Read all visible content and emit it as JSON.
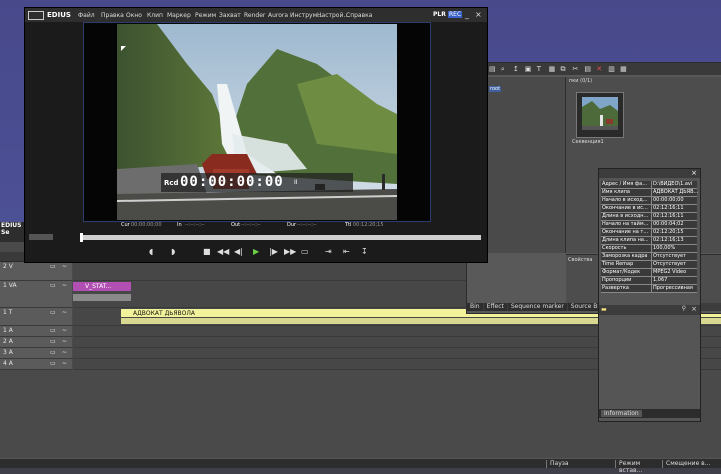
{
  "player": {
    "logo": "EDIUS",
    "menu": [
      "Файл",
      "Правка",
      "Окно",
      "Клип",
      "Маркер",
      "Режим",
      "Захват",
      "Render",
      "Aurora",
      "Инструм...",
      "Настрой...",
      "Справка"
    ],
    "plr": "PLR",
    "rec": "REC",
    "timecode_label": "Rcd",
    "timecode": "00:00:00:00",
    "timecode_suffix": "II",
    "cur_label": "Cur",
    "cur_value": "00:00:00;00",
    "in_label": "In",
    "in_value": "--:--:--;--",
    "out_label": "Out",
    "out_value": "--:--:--;--",
    "dur_label": "Dur",
    "dur_value": "--:--:--;--",
    "ttl_label": "Ttl",
    "ttl_value": "00:12:20;15"
  },
  "bin": {
    "folder": "root",
    "header": "пки (0/1)",
    "clip_name": "Секвенция1",
    "tabs": [
      "Bin",
      "Effect",
      "Sequence marker",
      "Source Brow"
    ],
    "props_label": "Свойства"
  },
  "info": {
    "rows": [
      {
        "k": "Адрес / Имя фа...",
        "v": "D:\\ВИДЕО\\1.avi"
      },
      {
        "k": "Имя клипа",
        "v": "АДВОКАТ ДЬЯВ..."
      },
      {
        "k": "Начало в исход...",
        "v": "00:00:00;00"
      },
      {
        "k": "Окончание в ис...",
        "v": "02:12:16;11"
      },
      {
        "k": "Длина в исходн...",
        "v": "02:12:16;11"
      },
      {
        "k": "Начало на тайм...",
        "v": "00:00:04;02"
      },
      {
        "k": "Окончание на т...",
        "v": "02:12:20;15"
      },
      {
        "k": "Длина клипа на...",
        "v": "02:12:16;13"
      },
      {
        "k": "Скорость",
        "v": "100,00%"
      },
      {
        "k": "Заморозка кадра",
        "v": "Отсутствует"
      },
      {
        "k": "Time Remap",
        "v": "Отсутствует"
      },
      {
        "k": "Формат/Кодек",
        "v": "MPEG2 Video"
      },
      {
        "k": "Пропорции",
        "v": "1,067"
      },
      {
        "k": "Развертка",
        "v": "Прогрессивная"
      }
    ],
    "tab": "Information"
  },
  "timeline": {
    "title": "EDIUS Se",
    "tracks": [
      {
        "id": "2 V",
        "h": 19
      },
      {
        "id": "1 VA",
        "h": 27
      },
      {
        "id": "1 T",
        "h": 18
      },
      {
        "id": "1 A",
        "h": 11
      },
      {
        "id": "2 A",
        "h": 11
      },
      {
        "id": "3 A",
        "h": 11
      },
      {
        "id": "4 A",
        "h": 11
      }
    ],
    "video_clip": "V_STAT...",
    "title_clip": "АДВОКАТ ДЬЯВОЛА"
  },
  "status": {
    "items": [
      "Пауза",
      "Режим встав...",
      "Смещение в..."
    ]
  }
}
